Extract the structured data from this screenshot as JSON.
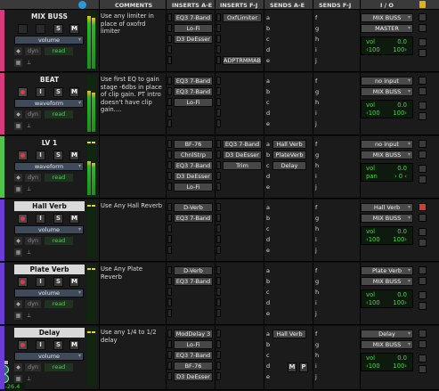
{
  "headers": {
    "comments": "COMMENTS",
    "inserts_ae": "INSERTS A-E",
    "inserts_fj": "INSERTS F-J",
    "sends_ae": "SENDS A-E",
    "sends_fj": "SENDS F-J",
    "io": "I / O"
  },
  "tracks": [
    {
      "name": "MIX BUSS",
      "view": "volume",
      "dyn": "dyn",
      "automation": "read",
      "comment": "Use any limiter in place of oxofrd limiter",
      "inserts_ae": [
        "EQ3 7-Band",
        "Lo-Fi",
        "D3 DeEsser",
        "",
        ""
      ],
      "inserts_fj": [
        "OxfLimiter",
        "",
        "",
        "",
        "ADPTRMMAB"
      ],
      "sends_ae": [
        "a",
        "b",
        "c",
        "d",
        "e"
      ],
      "send_names": [
        "",
        "",
        "",
        "",
        ""
      ],
      "sends_fj": [
        "f",
        "g",
        "h",
        "i",
        "j"
      ],
      "input": "MIX BUSS",
      "output": "MASTER",
      "vol_label": "vol",
      "vol": "0.0",
      "pan_l": "‹100",
      "pan_r": "100›",
      "color": "#d63a7a"
    },
    {
      "name": "BEAT",
      "view": "waveform",
      "dyn": "dyn",
      "automation": "read",
      "comment": "Use first EQ to gain stage -6dbs in place of clip gain. PT intro doesn't have clip gain....",
      "inserts_ae": [
        "EQ3 7-Band",
        "EQ3 7-Band",
        "Lo-Fi",
        "",
        ""
      ],
      "inserts_fj": [
        "",
        "",
        "",
        "",
        ""
      ],
      "sends_ae": [
        "a",
        "b",
        "c",
        "d",
        "e"
      ],
      "send_names": [
        "",
        "",
        "",
        "",
        ""
      ],
      "sends_fj": [
        "f",
        "g",
        "h",
        "i",
        "j"
      ],
      "input": "no input",
      "output": "MIX BUSS",
      "vol_label": "vol",
      "vol": "0.0",
      "pan_l": "‹100",
      "pan_r": "100›",
      "color": "#d63a7a"
    },
    {
      "name": "LV 1",
      "view": "waveform",
      "dyn": "dyn",
      "automation": "read",
      "comment": "",
      "inserts_ae": [
        "BF-76",
        "ChnlStrp",
        "EQ3 7-Band",
        "D3 DeEsser",
        "Lo-Fi"
      ],
      "inserts_fj": [
        "EQ3 7-Band",
        "D3 DeEsser",
        "Trim",
        "",
        ""
      ],
      "sends_ae": [
        "a",
        "b",
        "c",
        "d",
        "e"
      ],
      "send_names": [
        "Hall Verb",
        "PlateVerb",
        "Delay",
        "",
        ""
      ],
      "sends_fj": [
        "f",
        "g",
        "h",
        "i",
        "j"
      ],
      "input": "no input",
      "output": "MIX BUSS",
      "vol_label": "vol",
      "vol": "0.0",
      "pan_label": "pan",
      "pan": "› 0 ‹",
      "color": "#4fc34a"
    },
    {
      "name": "Hall Verb",
      "view": "volume",
      "dyn": "dyn",
      "automation": "read",
      "comment": "Use Any Hall Reverb",
      "inserts_ae": [
        "D-Verb",
        "EQ3 7-Band",
        "",
        "",
        ""
      ],
      "inserts_fj": [
        "",
        "",
        "",
        "",
        ""
      ],
      "sends_ae": [
        "a",
        "b",
        "c",
        "d",
        "e"
      ],
      "send_names": [
        "",
        "",
        "",
        "",
        ""
      ],
      "sends_fj": [
        "f",
        "g",
        "h",
        "i",
        "j"
      ],
      "input": "Hall Verb",
      "output": "MIX BUSS",
      "vol_label": "vol",
      "vol": "0.0",
      "pan_l": "‹100",
      "pan_r": "100›",
      "color": "#6a3bd6"
    },
    {
      "name": "Plate Verb",
      "view": "volume",
      "dyn": "dyn",
      "automation": "read",
      "comment": "Use Any Plate Reverb",
      "inserts_ae": [
        "D-Verb",
        "EQ3 7-Band",
        "",
        "",
        ""
      ],
      "inserts_fj": [
        "",
        "",
        "",
        "",
        ""
      ],
      "sends_ae": [
        "a",
        "b",
        "c",
        "d",
        "e"
      ],
      "send_names": [
        "",
        "",
        "",
        "",
        ""
      ],
      "sends_fj": [
        "f",
        "g",
        "h",
        "i",
        "j"
      ],
      "input": "Plate Verb",
      "output": "MIX BUSS",
      "vol_label": "vol",
      "vol": "0.0",
      "pan_l": "‹100",
      "pan_r": "100›",
      "color": "#6a3bd6"
    },
    {
      "name": "Delay",
      "view": "volume",
      "dyn": "dyn",
      "automation": "read",
      "comment": "Use any 1/4 to 1/2 delay",
      "inserts_ae": [
        "ModDelay 3",
        "Lo-Fi",
        "EQ3 7-Band",
        "BF-76",
        "D3 DeEsser"
      ],
      "inserts_fj": [
        "",
        "",
        "",
        "",
        ""
      ],
      "sends_ae": [
        "a",
        "b",
        "c",
        "d",
        "e"
      ],
      "send_names": [
        "Hall Verb",
        "",
        "",
        "",
        ""
      ],
      "sends_fj": [
        "f",
        "g",
        "h",
        "i",
        "j"
      ],
      "input": "Delay",
      "output": "MIX BUSS",
      "vol_label": "vol",
      "vol": "0.0",
      "pan_l": "‹100",
      "pan_r": "100›",
      "send_level": "-26.4",
      "send_m": "M",
      "send_p": "P",
      "color": "#6a3bd6"
    }
  ],
  "buttons": {
    "solo": "S",
    "mute": "M",
    "input_monitor": "I"
  }
}
